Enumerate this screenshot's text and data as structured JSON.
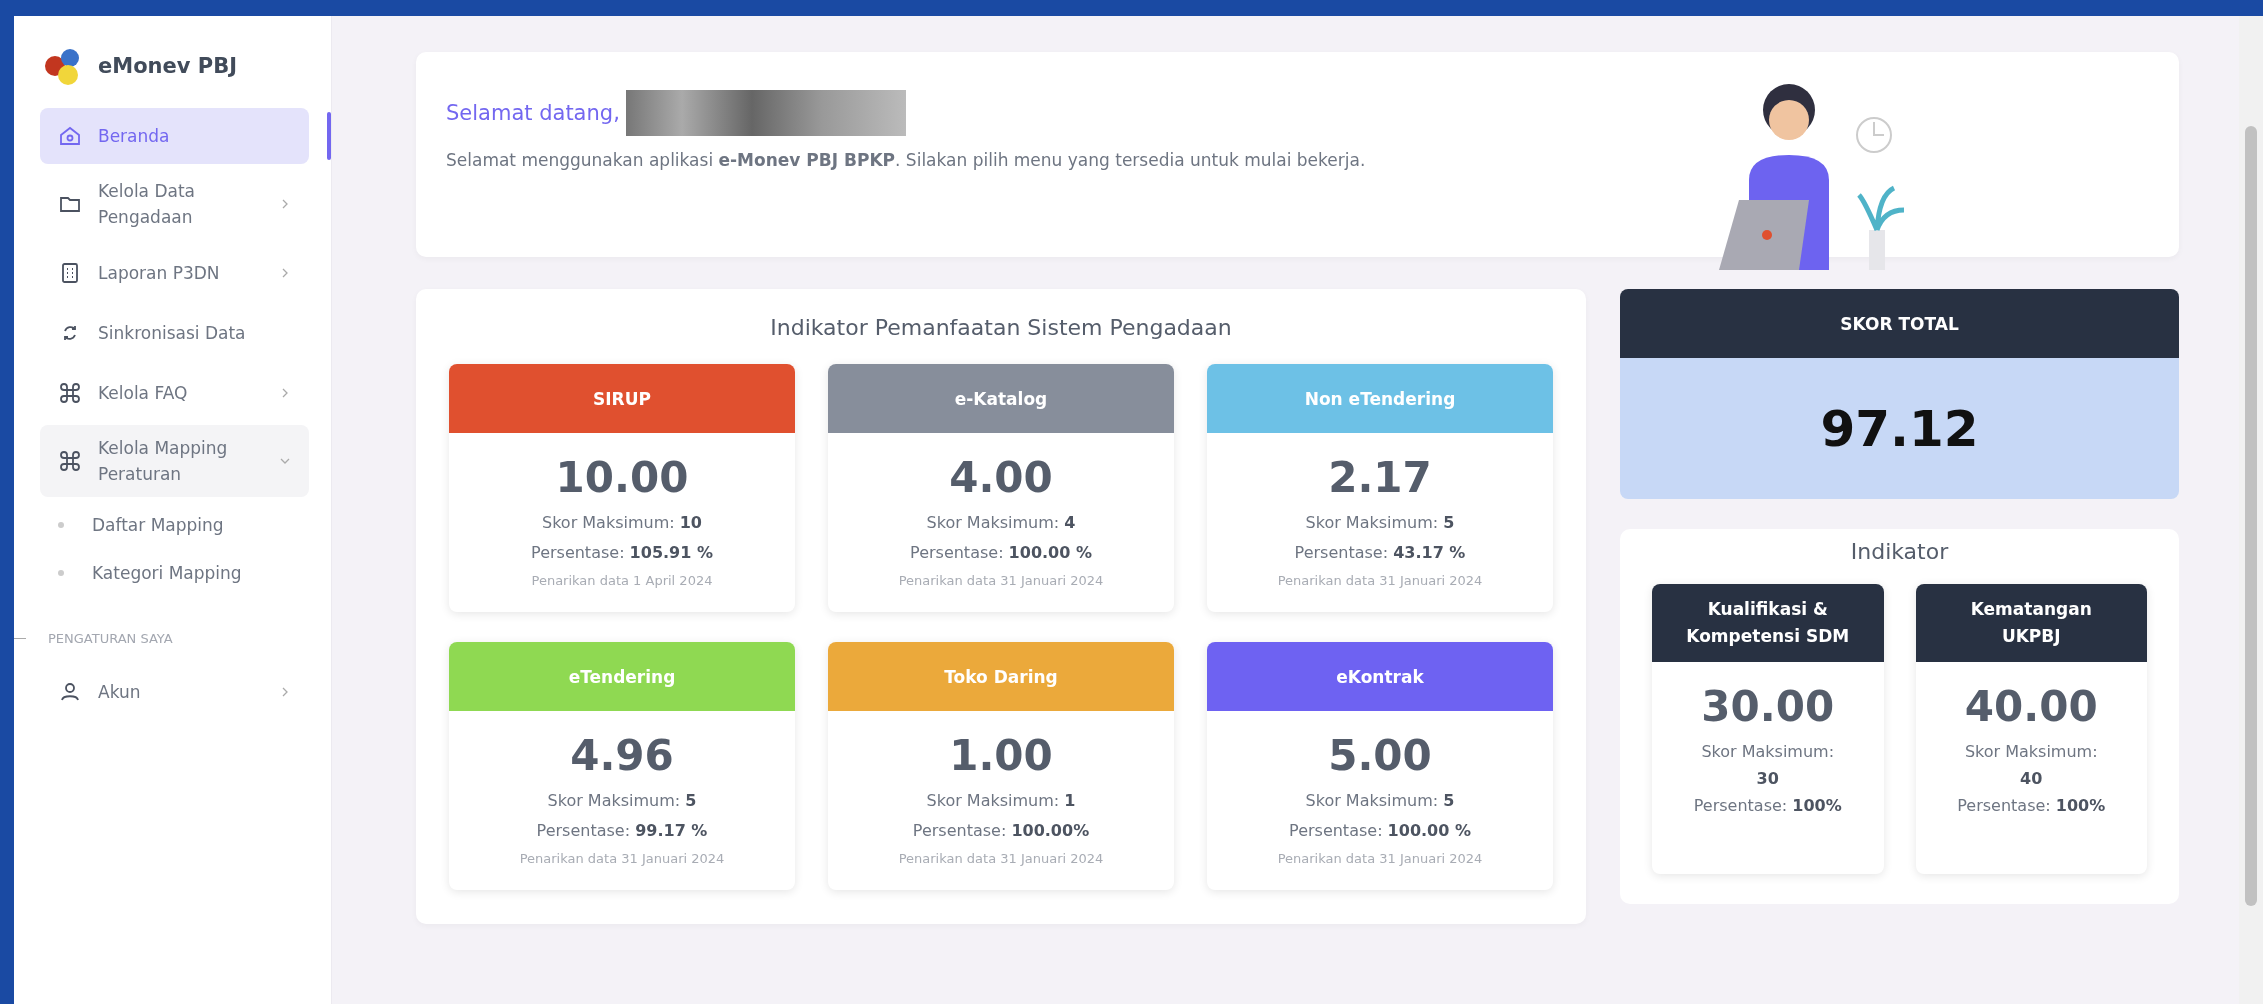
{
  "sidebar": {
    "logo_text": "eMonev PBJ",
    "items": [
      {
        "label": "Beranda",
        "kind": "link",
        "selected": true
      },
      {
        "label": "Kelola Data Pengadaan",
        "kind": "submenu",
        "selected": false,
        "expanded": false
      },
      {
        "label": "Laporan P3DN",
        "kind": "submenu",
        "selected": false,
        "expanded": false
      },
      {
        "label": "Sinkronisasi Data",
        "kind": "link",
        "selected": false
      },
      {
        "label": "Kelola FAQ",
        "kind": "submenu",
        "selected": false,
        "expanded": false
      },
      {
        "label": "Kelola Mapping Peraturan",
        "kind": "submenu",
        "selected": false,
        "expanded": true,
        "children": [
          {
            "label": "Daftar Mapping",
            "selected": false
          },
          {
            "label": "Kategori Mapping",
            "selected": false
          }
        ]
      }
    ],
    "section_label": "PENGATURAN SAYA",
    "account_items": [
      {
        "label": "Akun",
        "kind": "submenu",
        "selected": false,
        "expanded": false
      }
    ]
  },
  "welcome": {
    "greeting": "Selamat datang,",
    "message": "Selamat menggunakan aplikasi **e-Monev PBJ BPKP**. Silakan pilih menu yang tersedia untuk mulai bekerja."
  },
  "indicator_panel": {
    "title": "Indikator Pemanfaatan Sistem Pengadaan",
    "cards": [
      {
        "title": "SIRUP",
        "color": "#e0502f",
        "score": "10.00",
        "max": "Skor Maksimum: **10**",
        "percentage": "Persentase: **105.91 %**",
        "note": "Penarikan data 1 April 2024"
      },
      {
        "title": "e-Katalog",
        "color": "#878e9b",
        "score": "4.00",
        "max": "Skor Maksimum: **4**",
        "percentage": "Persentase: **100.00 %**",
        "note": "Penarikan data 31 Januari 2024"
      },
      {
        "title": "Non eTendering",
        "color": "#6dc1e6",
        "score": "2.17",
        "max": "Skor Maksimum: **5**",
        "percentage": "Persentase: **43.17 %**",
        "note": "Penarikan data 31 Januari 2024"
      },
      {
        "title": "eTendering",
        "color": "#8fd952",
        "score": "4.96",
        "max": "Skor Maksimum: **5**",
        "percentage": "Persentase: **99.17 %**",
        "note": "Penarikan data 31 Januari 2024"
      },
      {
        "title": "Toko Daring",
        "color": "#eba93b",
        "score": "1.00",
        "max": "Skor Maksimum: **1**",
        "percentage": "Persentase: **100.00%**",
        "note": "Penarikan data 31 Januari 2024"
      },
      {
        "title": "eKontrak",
        "color": "#6e62f2",
        "score": "5.00",
        "max": "Skor Maksimum: **5**",
        "percentage": "Persentase: **100.00 %**",
        "note": "Penarikan data 31 Januari 2024"
      }
    ]
  },
  "total_score": {
    "title": "SKOR TOTAL",
    "value": "97.12"
  },
  "indikator": {
    "title": "Indikator",
    "cards": [
      {
        "title": "Kualifikasi & Kompetensi SDM",
        "score": "30.00",
        "max_label": "Skor Maksimum:",
        "max_value": "30",
        "percentage": "Persentase: **100%**"
      },
      {
        "title": "Kematangan UKPBJ",
        "score": "40.00",
        "max_label": "Skor Maksimum:",
        "max_value": "40",
        "percentage": "Persentase: **100%**"
      }
    ]
  }
}
